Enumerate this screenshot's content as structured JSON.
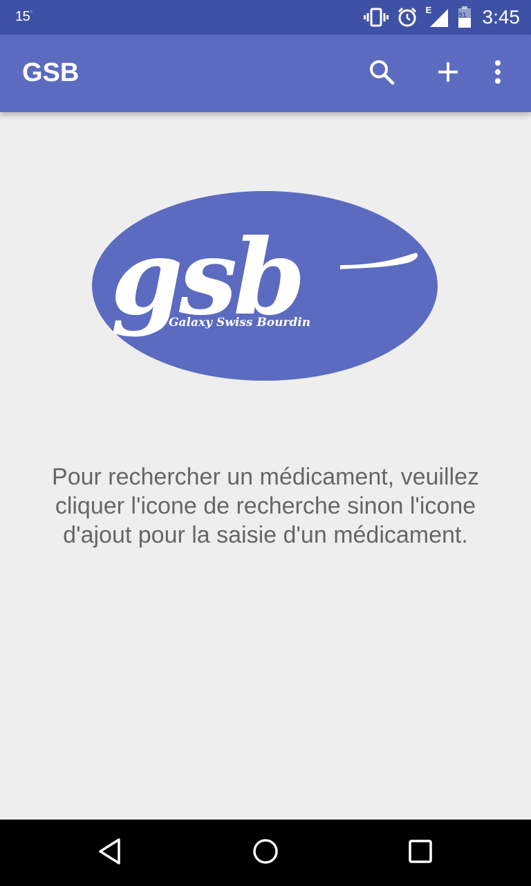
{
  "status_bar": {
    "temperature": "15",
    "degree": "°",
    "network_type": "E",
    "battery_level": "51",
    "time": "3:45",
    "icons": [
      "vibrate-icon",
      "alarm-icon",
      "signal-icon",
      "battery-icon"
    ]
  },
  "app_bar": {
    "title": "GSB",
    "actions": [
      "search-icon",
      "add-icon",
      "more-vert-icon"
    ]
  },
  "logo": {
    "wordmark": "gsb",
    "tagline": "Galaxy Swiss Bourdin"
  },
  "main": {
    "hint_text": "Pour rechercher un médicament, veuillez cliquer l'icone de recherche sinon l'icone d'ajout pour la saisie d'un médicament."
  },
  "nav_bar": {
    "buttons": [
      "back-icon",
      "home-icon",
      "recents-icon"
    ]
  },
  "colors": {
    "status_bar": "#3f51a5",
    "app_bar": "#5c6bc0",
    "background": "#eeeeee",
    "logo_fill": "#5c6bc0",
    "hint_text": "#666666"
  }
}
